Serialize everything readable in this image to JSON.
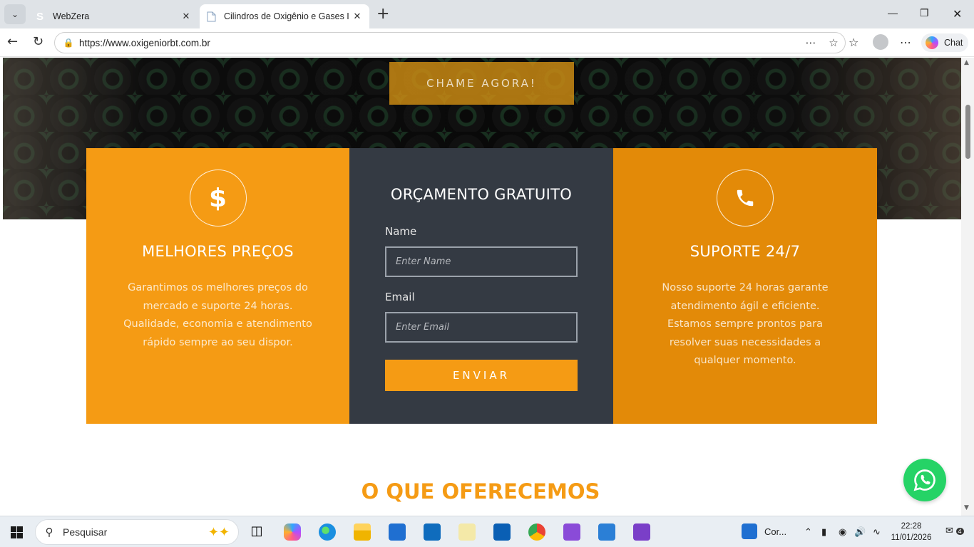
{
  "browser": {
    "tabs": [
      {
        "title": "WebZera",
        "favicon": "S"
      },
      {
        "title": "Cilindros de Oxigênio e Gases Indu"
      }
    ],
    "url": "https://www.oxigeniorbt.com.br",
    "chat_label": "Chat"
  },
  "hero": {
    "cta_label": "CHAME AGORA!"
  },
  "features": {
    "left": {
      "icon": "$",
      "title": "MELHORES PREÇOS",
      "text": "Garantimos os melhores preços do mercado e suporte 24 horas. Qualidade, economia e atendimento rápido sempre ao seu dispor."
    },
    "form": {
      "title": "ORÇAMENTO GRATUITO",
      "name_label": "Name",
      "name_placeholder": "Enter Name",
      "email_label": "Email",
      "email_placeholder": "Enter Email",
      "submit_label": "ENVIAR"
    },
    "right": {
      "title": "SUPORTE 24/7",
      "text": "Nosso suporte 24 horas garante atendimento ágil e eficiente. Estamos sempre prontos para resolver suas necessidades a qualquer momento."
    }
  },
  "offer": {
    "title": "O QUE OFERECEMOS"
  },
  "taskbar": {
    "search_label": "Pesquisar",
    "app_label": "Cor...",
    "time": "22:28",
    "date": "11/01/2026",
    "notification_count": "4"
  },
  "colors": {
    "accent": "#f59b14",
    "accent_dark": "#e38a08",
    "form_bg": "#343a43",
    "whatsapp": "#25d366"
  }
}
